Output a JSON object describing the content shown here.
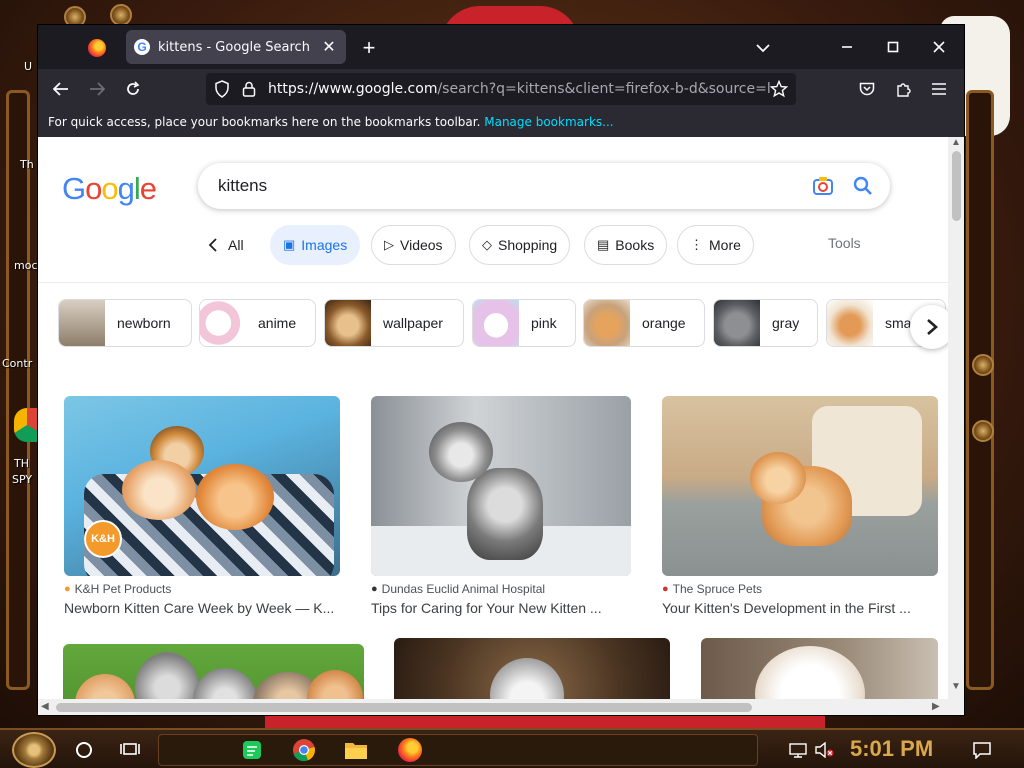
{
  "browser": {
    "tab_title": "kittens - Google Search",
    "url_host": "https://www.google.com",
    "url_rest": "/search?q=kittens&client=firefox-b-d&source=lnms&",
    "bookmarks_hint": "For quick access, place your bookmarks here on the bookmarks toolbar.",
    "manage_bookmarks": "Manage bookmarks..."
  },
  "google": {
    "logo_letters": [
      "G",
      "o",
      "o",
      "g",
      "l",
      "e"
    ],
    "logo_colors": [
      "#4285f4",
      "#ea4335",
      "#fbbc05",
      "#4285f4",
      "#34a853",
      "#ea4335"
    ],
    "query": "kittens",
    "filters": {
      "all": "All",
      "images": "Images",
      "videos": "Videos",
      "shopping": "Shopping",
      "books": "Books",
      "more": "More",
      "tools": "Tools"
    },
    "suggestions": [
      "newborn",
      "anime",
      "wallpaper",
      "pink",
      "orange",
      "gray",
      "sma"
    ],
    "results": [
      {
        "source": "K&H Pet Products",
        "title": "Newborn Kitten Care Week by Week — K..."
      },
      {
        "source": "Dundas Euclid Animal Hospital",
        "title": "Tips for Caring for Your New Kitten ..."
      },
      {
        "source": "The Spruce Pets",
        "title": "Your Kitten's Development in the First ..."
      }
    ],
    "watermark": "K&H"
  },
  "desktop": {
    "labels": [
      "U",
      "Th",
      "moc",
      "Contr",
      "TH",
      "SPY"
    ]
  },
  "taskbar": {
    "clock": "5:01 PM"
  }
}
